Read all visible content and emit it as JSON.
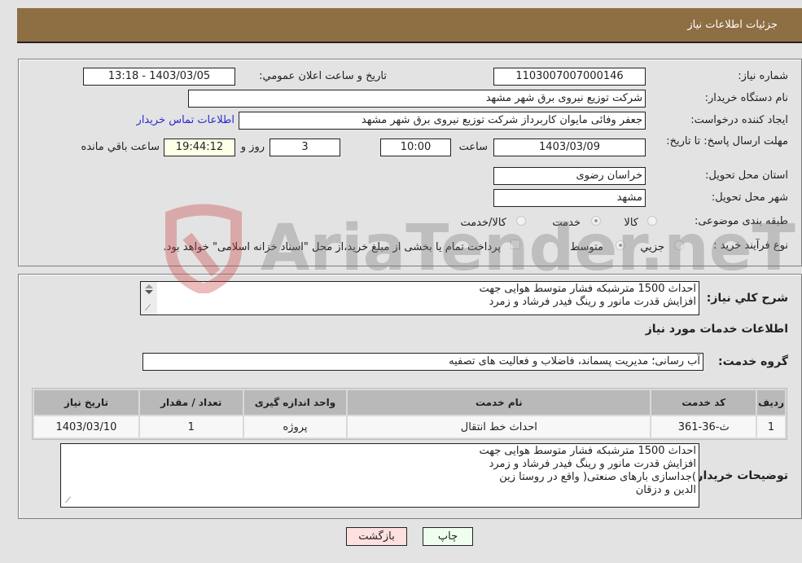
{
  "header": {
    "title": "جزئیات اطلاعات نیاز"
  },
  "form": {
    "need_number": {
      "label": "شماره نیاز:",
      "value": "1103007007000146"
    },
    "announce_datetime": {
      "label": "تاريخ و ساعت اعلان عمومي:",
      "value": "1403/03/05 - 13:18"
    },
    "buyer_org": {
      "label": "نام دستگاه خريدار:",
      "value": "شرکت توزیع نیروی برق شهر مشهد"
    },
    "requester": {
      "label": "ايجاد کننده درخواست:",
      "value": "جعفر وفائی مایوان کاربرداز شرکت توزیع نیروی برق شهر مشهد"
    },
    "contact_link": "اطلاعات تماس خريدار",
    "deadline": {
      "label": "مهلت ارسال پاسخ: تا تاريخ:",
      "date": "1403/03/09",
      "time_label": "ساعت",
      "time": "10:00",
      "days": "3",
      "days_label": "روز و",
      "remaining": "19:44:12",
      "remaining_label": "ساعت باقي مانده"
    },
    "province": {
      "label": "استان محل تحويل:",
      "value": "خراسان رضوی"
    },
    "city": {
      "label": "شهر محل تحويل:",
      "value": "مشهد"
    },
    "category": {
      "label": "طبقه بندی موضوعی:",
      "options": [
        "کالا",
        "خدمت",
        "کالا/خدمت"
      ],
      "selected": "خدمت"
    },
    "purchase_type": {
      "label": "نوع فرآيند خريد :",
      "options": [
        "جزيي",
        "متوسط"
      ],
      "selected": "متوسط",
      "treasury_note": "پرداخت تمام یا بخشی از مبلغ خرید،از محل \"اسناد خزانه اسلامی\" خواهد بود."
    }
  },
  "summary": {
    "label": "شرح کلي نياز:",
    "text": "احداث 1500 مترشبکه فشار متوسط هوایی جهت\nافزایش قدرت مانور و رینگ فیدر فرشاد و زمرد"
  },
  "services": {
    "section_title": "اطلاعات خدمات مورد نياز",
    "group_label": "گروه خدمت:",
    "group_value": "آب رسانی؛ مدیریت پسماند، فاضلاب و فعالیت های تصفیه",
    "table": {
      "headers": [
        "رديف",
        "کد خدمت",
        "نام خدمت",
        "واحد اندازه گيری",
        "تعداد / مقدار",
        "تاريخ نياز"
      ],
      "rows": [
        [
          "1",
          "ث-36-361",
          "احداث خط انتقال",
          "پروژه",
          "1",
          "1403/03/10"
        ]
      ]
    }
  },
  "buyer_notes": {
    "label": "توضيحات خريدار:",
    "text": "احداث 1500 مترشبکه فشار متوسط هوایی جهت\nافزایش قدرت مانور و رینگ فیدر فرشاد و زمرد\n)جداسازی بارهای صنعتی( واقع در روستا زین\nالدین و دزقان"
  },
  "buttons": {
    "print": "چاپ",
    "back": "بازگشت"
  },
  "watermark": "AriaTender.neT"
}
